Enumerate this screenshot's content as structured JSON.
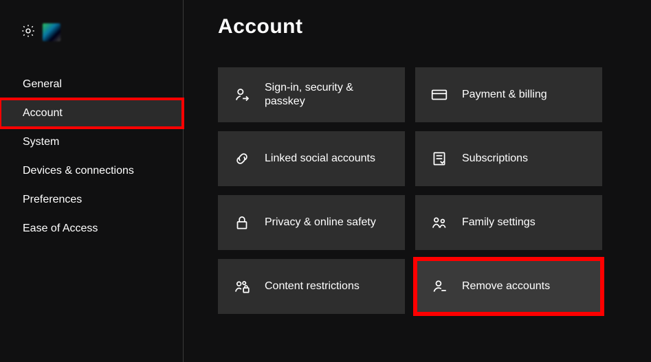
{
  "sidebar": {
    "items": [
      {
        "label": "General"
      },
      {
        "label": "Account"
      },
      {
        "label": "System"
      },
      {
        "label": "Devices & connections"
      },
      {
        "label": "Preferences"
      },
      {
        "label": "Ease of Access"
      }
    ],
    "selected_index": 1,
    "highlight_index": 1
  },
  "page": {
    "title": "Account"
  },
  "tiles": [
    {
      "icon": "person-arrow-icon",
      "label": "Sign-in, security &\npasskey"
    },
    {
      "icon": "card-icon",
      "label": "Payment & billing"
    },
    {
      "icon": "link-icon",
      "label": "Linked social accounts"
    },
    {
      "icon": "receipt-icon",
      "label": "Subscriptions"
    },
    {
      "icon": "lock-icon",
      "label": "Privacy & online safety"
    },
    {
      "icon": "family-icon",
      "label": "Family settings"
    },
    {
      "icon": "person-lock-icon",
      "label": "Content restrictions"
    },
    {
      "icon": "person-minus-icon",
      "label": "Remove accounts"
    }
  ],
  "highlight_tile_index": 7,
  "colors": {
    "highlight": "#ff0000",
    "tile_bg": "#2e2e2e",
    "tile_bg_active": "#3a3a3a",
    "page_bg": "#101011"
  }
}
